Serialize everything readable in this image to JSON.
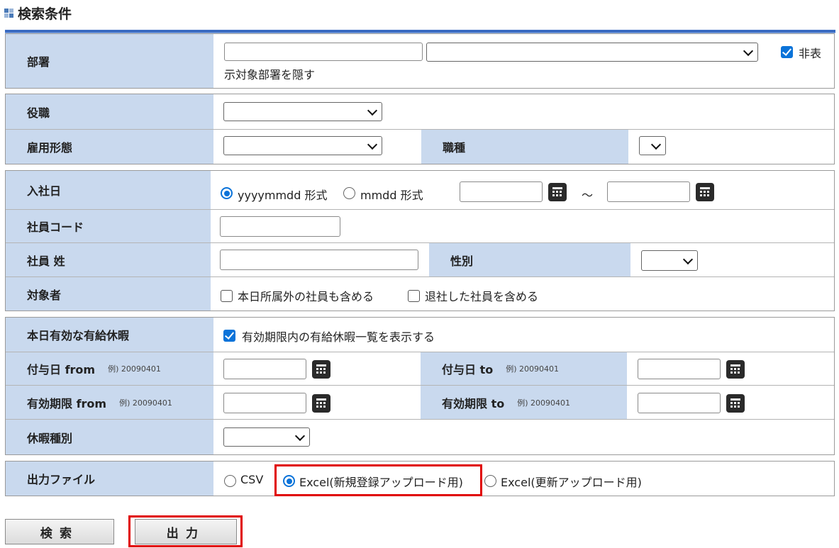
{
  "header": {
    "title": "検索条件"
  },
  "busho": {
    "label": "部署",
    "code_value": "",
    "select_value": "",
    "hide_checked": true,
    "hide_label_part1": "非表",
    "hide_label_part2": "示対象部署を隠す"
  },
  "yakushoku": {
    "label": "役職",
    "select_value": ""
  },
  "koyo": {
    "label": "雇用形態",
    "select_value": ""
  },
  "shokushu": {
    "label": "職種",
    "select_value": ""
  },
  "nyusha": {
    "label": "入社日",
    "format_option1": "yyyymmdd 形式",
    "format_option2": "mmdd 形式",
    "selected_format": "yyyymmdd 形式",
    "from_value": "",
    "to_value": "",
    "tilde": "～"
  },
  "shain_code": {
    "label": "社員コード",
    "value": ""
  },
  "shain_sei": {
    "label": "社員 姓",
    "value": ""
  },
  "seibetsu": {
    "label": "性別",
    "select_value": ""
  },
  "taishosha": {
    "label": "対象者",
    "option1": "本日所属外の社員も含める",
    "option2": "退社した社員を含める",
    "option1_checked": false,
    "option2_checked": false
  },
  "yukyu": {
    "label": "本日有効な有給休暇",
    "checkbox_label": "有効期限内の有給休暇一覧を表示する",
    "checked": true
  },
  "fuyo_from": {
    "label": "付与日 from",
    "example": "例) 20090401",
    "value": ""
  },
  "fuyo_to": {
    "label": "付与日 to",
    "example": "例) 20090401",
    "value": ""
  },
  "kigen_from": {
    "label": "有効期限 from",
    "example": "例) 20090401",
    "value": ""
  },
  "kigen_to": {
    "label": "有効期限 to",
    "example": "例) 20090401",
    "value": ""
  },
  "kyuka_shubetsu": {
    "label": "休暇種別",
    "select_value": ""
  },
  "output_file": {
    "label": "出力ファイル",
    "option_csv": "CSV",
    "option_excel_new": "Excel(新規登録アップロード用)",
    "option_excel_update": "Excel(更新アップロード用)",
    "selected": "Excel(新規登録アップロード用)"
  },
  "buttons": {
    "search": "検索",
    "output": "出力"
  },
  "colors": {
    "label_bg": "#c9d9ee",
    "accent": "#0b73d9",
    "highlight": "#e00000",
    "topline": "#3b6cc2"
  }
}
